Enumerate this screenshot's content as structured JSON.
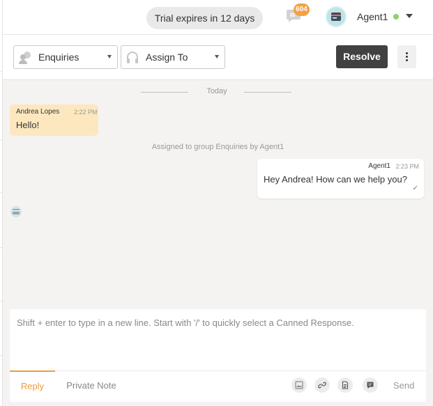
{
  "header": {
    "trial_text": "Trial expires in 12 days",
    "notification_count": "604",
    "agent_name": "Agent1",
    "agent_status_color": "#8fd16a"
  },
  "toolbar": {
    "group_select": "Enquiries",
    "assign_select": "Assign To",
    "resolve_label": "Resolve"
  },
  "conversation": {
    "date_divider": "Today",
    "messages": [
      {
        "sender": "Andrea Lopes",
        "time": "2:22 PM",
        "text": "Hello!",
        "direction": "incoming"
      },
      {
        "sender": "Agent1",
        "time": "2:23 PM",
        "text": "Hey Andrea! How can we help you?",
        "direction": "outgoing"
      }
    ],
    "system_note": "Assigned to group Enquiries by Agent1"
  },
  "composer": {
    "placeholder": "Shift + enter to type in a new line. Start with '/' to quickly select a Canned Response.",
    "tabs": [
      "Reply",
      "Private Note"
    ],
    "send_label": "Send"
  },
  "colors": {
    "accent": "#f19a3e",
    "incoming_bubble": "#fde7bf",
    "resolve_button": "#414141",
    "badge": "#f5a142"
  },
  "icons": [
    "chat-bubble-icon",
    "card-avatar-icon",
    "chevron-down-icon",
    "group-icon",
    "headset-icon",
    "more-vertical-icon",
    "image-icon",
    "link-icon",
    "document-icon",
    "comment-icon",
    "check-icon"
  ]
}
